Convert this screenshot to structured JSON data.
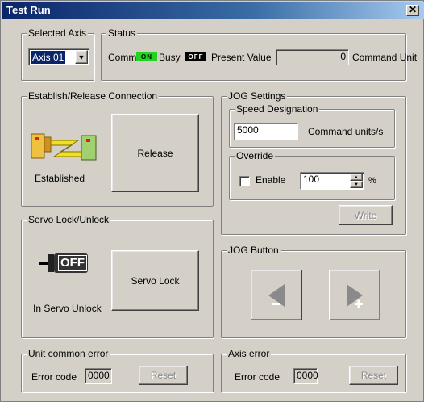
{
  "window": {
    "title": "Test Run",
    "close_label": "✕"
  },
  "selected_axis": {
    "legend": "Selected Axis",
    "value": "Axis 01"
  },
  "status": {
    "legend": "Status",
    "comm_label": "Comm",
    "comm_indicator": "ON",
    "busy_label": "Busy",
    "busy_indicator": "OFF",
    "present_value_label": "Present Value",
    "present_value": "0",
    "unit_label": "Command Unit"
  },
  "connection": {
    "legend": "Establish/Release Connection",
    "state": "Established",
    "button": "Release"
  },
  "servo": {
    "legend": "Servo Lock/Unlock",
    "icon_text": "OFF",
    "state": "In Servo Unlock",
    "button": "Servo Lock"
  },
  "jog_settings": {
    "legend": "JOG Settings",
    "speed_legend": "Speed Designation",
    "speed_value": "5000",
    "speed_unit": "Command units/s",
    "override_legend": "Override",
    "enable_label": "Enable",
    "override_value": "100",
    "override_unit": "%",
    "write_button": "Write"
  },
  "jog_button": {
    "legend": "JOG Button"
  },
  "unit_error": {
    "legend": "Unit common error",
    "code_label": "Error code",
    "code": "0000",
    "reset": "Reset"
  },
  "axis_error": {
    "legend": "Axis error",
    "code_label": "Error code",
    "code": "0000",
    "reset": "Reset"
  },
  "colors": {
    "title_start": "#0a246a",
    "title_end": "#a6caf0",
    "on_indicator": "#22d322",
    "face": "#d4d0c8"
  }
}
